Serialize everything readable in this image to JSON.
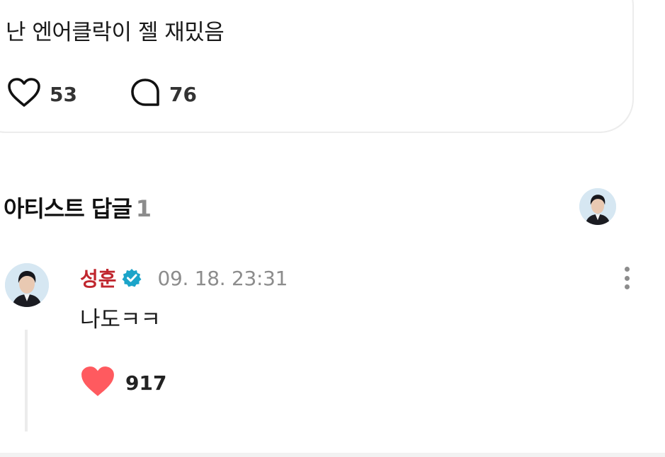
{
  "post": {
    "text": "난 엔어클락이 젤 재밌음",
    "like_count": "53",
    "comment_count": "76"
  },
  "artist_replies": {
    "title": "아티스트 답글",
    "count": "1"
  },
  "reply": {
    "author": "성훈",
    "timestamp": "09. 18. 23:31",
    "text": "나도ㅋㅋ",
    "like_count": "917",
    "liked": true
  },
  "colors": {
    "author": "#c0262e",
    "verified": "#1ba4c9",
    "liked_heart": "#ff5a5f"
  }
}
